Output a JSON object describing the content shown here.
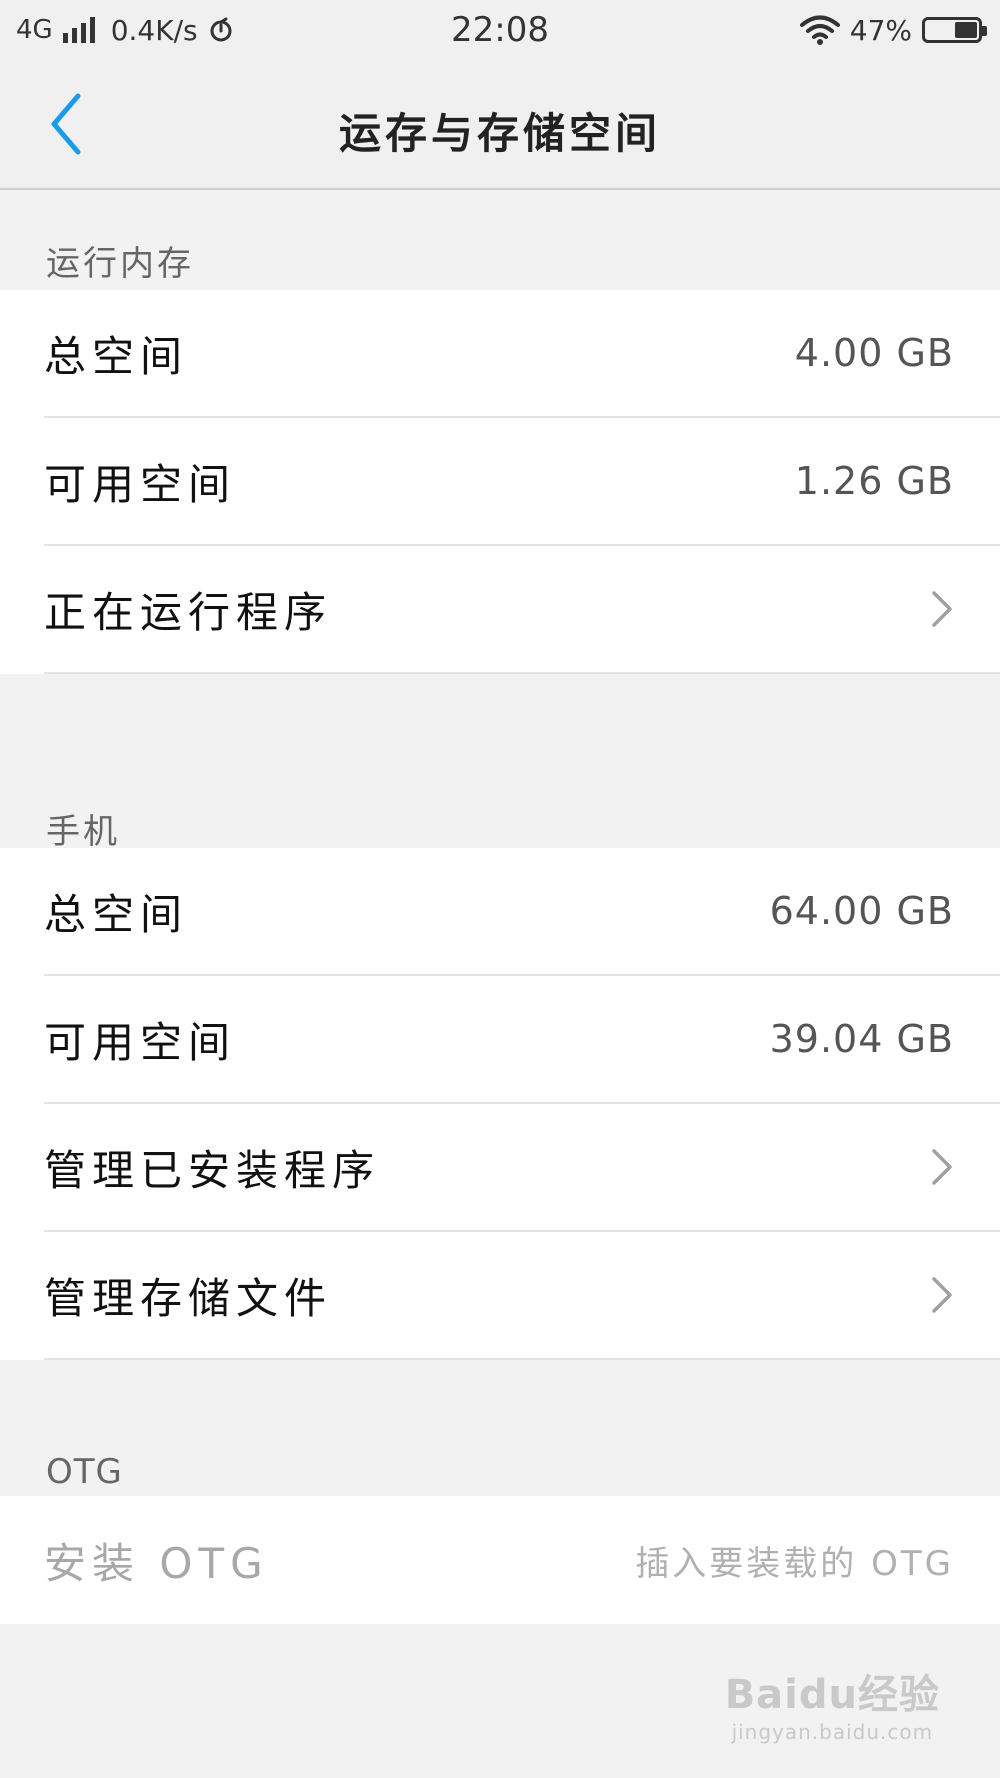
{
  "status_bar": {
    "network": "4G",
    "speed": "0.4K/s",
    "time": "22:08",
    "battery_text": "47%",
    "battery_level": 0.47,
    "icons": [
      "signal-icon",
      "sync-icon",
      "wifi-icon",
      "battery-icon"
    ]
  },
  "header": {
    "title": "运存与存储空间",
    "back_icon": "chevron-left-icon",
    "accent": "#1a9bea"
  },
  "sections": {
    "ram": {
      "label": "运行内存",
      "rows": [
        {
          "label": "总空间",
          "value": "4.00 GB"
        },
        {
          "label": "可用空间",
          "value": "1.26 GB"
        },
        {
          "label": "正在运行程序"
        }
      ]
    },
    "phone": {
      "label": "手机",
      "rows": [
        {
          "label": "总空间",
          "value": "64.00 GB"
        },
        {
          "label": "可用空间",
          "value": "39.04 GB"
        },
        {
          "label": "管理已安装程序"
        },
        {
          "label": "管理存储文件"
        }
      ]
    },
    "otg": {
      "label": "OTG",
      "rows": [
        {
          "label": "安装 OTG",
          "value": "插入要装载的 OTG"
        }
      ]
    }
  },
  "watermark": {
    "main": "Baidu经验",
    "sub": "jingyan.baidu.com"
  }
}
